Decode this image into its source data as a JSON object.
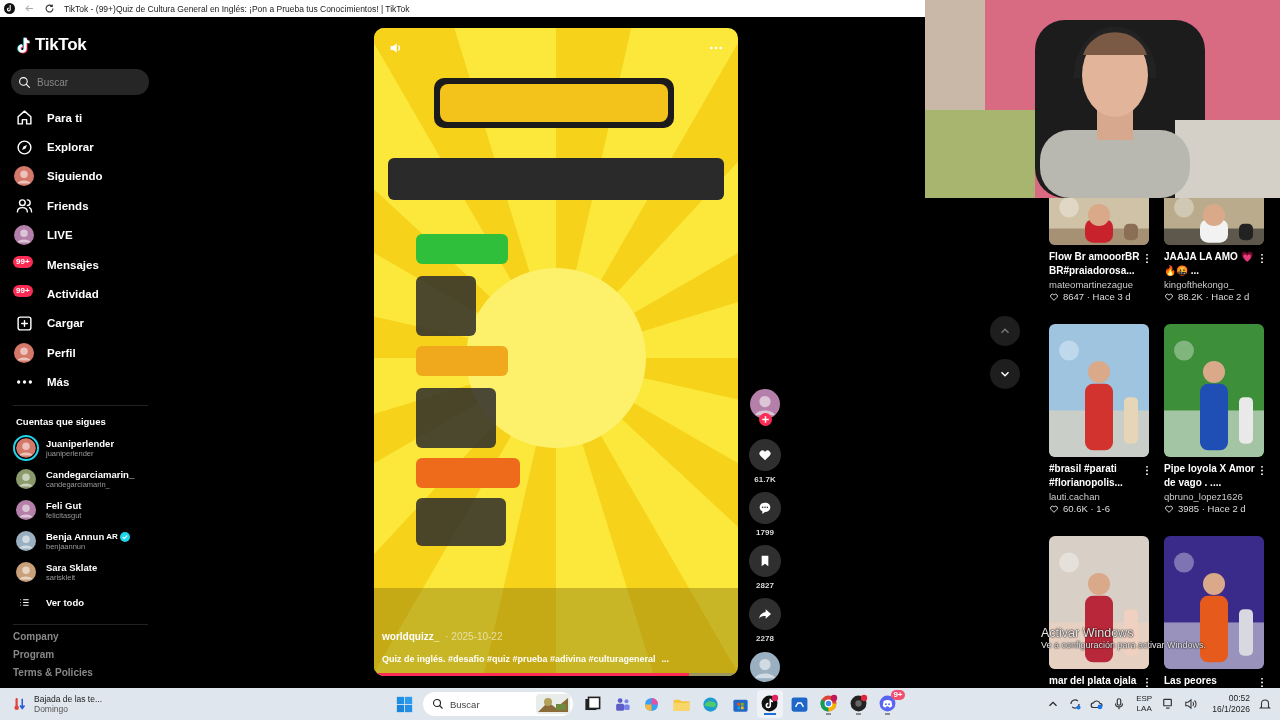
{
  "browser": {
    "tab_title": "TikTok - (99+)Quiz de Cultura General en Inglés: ¡Pon a Prueba tus Conocimientos! | TikTok"
  },
  "sidebar": {
    "logo": "TikTok",
    "search": {
      "placeholder": "Buscar"
    },
    "nav": [
      {
        "label": "Para ti",
        "kind": "home",
        "selected": false
      },
      {
        "label": "Explorar",
        "kind": "compass",
        "selected": false
      },
      {
        "label": "Siguiendo",
        "kind": "avatar",
        "selected": false
      },
      {
        "label": "Friends",
        "kind": "friends",
        "selected": false
      },
      {
        "label": "LIVE",
        "kind": "avatar",
        "selected": false
      },
      {
        "label": "Mensajes",
        "badge": "99+",
        "selected": false
      },
      {
        "label": "Actividad",
        "badge": "99+",
        "selected": false
      },
      {
        "label": "Cargar",
        "kind": "upload",
        "selected": false
      },
      {
        "label": "Perfil",
        "kind": "avatar",
        "selected": false
      },
      {
        "label": "Más",
        "kind": "more",
        "selected": false
      }
    ],
    "following_title": "Cuentas que sigues",
    "following": [
      {
        "name": "Juaniperlender",
        "handle": "juaniperlender",
        "live": true,
        "verified": false
      },
      {
        "name": "Candegarciamarin_",
        "handle": "candegarciamarin_",
        "live": false,
        "verified": false
      },
      {
        "name": "Feli Gut",
        "handle": "felicitasgut",
        "live": false,
        "verified": false
      },
      {
        "name": "Benja Annun",
        "flag": "AR",
        "handle": "benjaannun",
        "live": false,
        "verified": true
      },
      {
        "name": "Sara Sklate",
        "handle": "sariskleit",
        "live": false,
        "verified": false
      }
    ],
    "see_all": "Ver todo",
    "footer_links": [
      "Company",
      "Program",
      "Terms & Policies"
    ]
  },
  "video": {
    "author": "worldquizz_",
    "date": "· 2025-10-22",
    "caption": "Quiz de inglés. #desafio #quiz #prueba #adivina #culturageneral",
    "more": "...",
    "progress": {
      "level": 0.87
    }
  },
  "actions": [
    {
      "kind": "like",
      "count": "61.7K"
    },
    {
      "kind": "comment",
      "count": "1799"
    },
    {
      "kind": "save",
      "count": "2827"
    },
    {
      "kind": "share",
      "count": "2278"
    }
  ],
  "recommended": [
    {
      "title": "Flow Br amooorBR BR#praiadorosa...",
      "author": "mateomartinezague",
      "stats": "8647 · Hace 3 d"
    },
    {
      "title": "JAAJA LA AMO 💗 🔥🤬 ...",
      "author": "kingofthekongo_",
      "stats": "88.2K · Hace 2 d"
    },
    {
      "title": "#brasil #parati #florianopolis...",
      "author": "lauti.cachan",
      "stats": "60.6K · 1-6"
    },
    {
      "title": "Pipe loyola X Amor de vago . ....",
      "author": "qbruno_lopez1626",
      "stats": "3985 · Hace 2 d"
    },
    {
      "title": "mar del plata ojala"
    },
    {
      "title": "Las peores"
    }
  ],
  "activation_notice": {
    "title": "Activar Windows",
    "text": "Ve a configuración para activar Windows."
  },
  "taskbar": {
    "widget": {
      "title": "Bajada de las te...",
      "subtitle": "Domingo"
    },
    "search": {
      "placeholder": "Buscar"
    },
    "apps": [
      {
        "kind": "taskview",
        "open": false,
        "selected": false
      },
      {
        "kind": "teams",
        "open": false,
        "selected": false
      },
      {
        "kind": "copilot",
        "open": false,
        "selected": false
      },
      {
        "kind": "files",
        "open": false,
        "selected": false
      },
      {
        "kind": "edge",
        "open": false,
        "selected": false
      },
      {
        "kind": "store",
        "open": false,
        "selected": false
      },
      {
        "kind": "tiktok",
        "open": true,
        "selected": true
      },
      {
        "kind": "remote",
        "open": false,
        "selected": false
      },
      {
        "kind": "chrome",
        "open": true,
        "selected": false
      },
      {
        "kind": "recorder",
        "open": true,
        "selected": false
      },
      {
        "kind": "discord",
        "badge": "9+",
        "open": true,
        "selected": false
      }
    ],
    "tray": {
      "language": "ESP",
      "layout": "LAA",
      "time": "00:52",
      "date": "16/1/2026"
    }
  }
}
